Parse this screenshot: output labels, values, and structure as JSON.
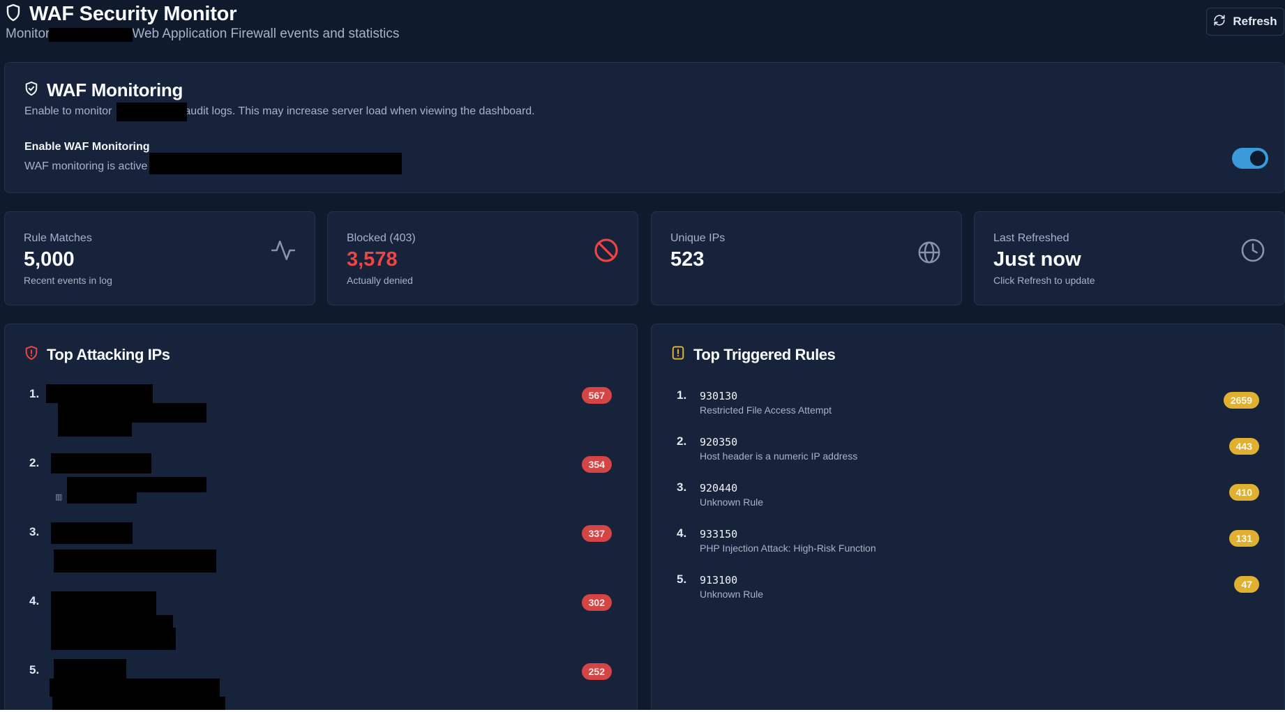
{
  "header": {
    "title": "WAF Security Monitor",
    "subtitle_start": "Monitor",
    "subtitle_end": "Web Application Firewall events and statistics",
    "refresh_label": "Refresh"
  },
  "monitoring": {
    "title": "WAF Monitoring",
    "desc_start": "Enable to monitor",
    "desc_end": "audit logs. This may increase server load when viewing the dashboard.",
    "setting_label": "Enable WAF Monitoring",
    "setting_status": "WAF monitoring is active",
    "enabled": true
  },
  "stats": [
    {
      "label": "Rule Matches",
      "value": "5,000",
      "sub": "Recent events in log",
      "icon": "activity-icon"
    },
    {
      "label": "Blocked (403)",
      "value": "3,578",
      "sub": "Actually denied",
      "icon": "ban-icon"
    },
    {
      "label": "Unique IPs",
      "value": "523",
      "sub": "",
      "icon": "globe-icon"
    },
    {
      "label": "Last Refreshed",
      "value": "Just now",
      "sub": "Click Refresh to update",
      "icon": "clock-icon"
    }
  ],
  "top_ips": {
    "title": "Top Attacking IPs",
    "items": [
      {
        "rank": "1.",
        "count": "567"
      },
      {
        "rank": "2.",
        "count": "354"
      },
      {
        "rank": "3.",
        "count": "337"
      },
      {
        "rank": "4.",
        "count": "302"
      },
      {
        "rank": "5.",
        "count": "252"
      }
    ]
  },
  "top_rules": {
    "title": "Top Triggered Rules",
    "items": [
      {
        "rank": "1.",
        "id": "930130",
        "desc": "Restricted File Access Attempt",
        "count": "2659"
      },
      {
        "rank": "2.",
        "id": "920350",
        "desc": "Host header is a numeric IP address",
        "count": "443"
      },
      {
        "rank": "3.",
        "id": "920440",
        "desc": "Unknown Rule",
        "count": "410"
      },
      {
        "rank": "4.",
        "id": "933150",
        "desc": "PHP Injection Attack: High-Risk Function",
        "count": "131"
      },
      {
        "rank": "5.",
        "id": "913100",
        "desc": "Unknown Rule",
        "count": "47"
      }
    ]
  },
  "colors": {
    "background": "#0f1a2d",
    "card": "#17233a",
    "accent": "#3b9ad9",
    "danger": "#ef4444",
    "warning": "#e0b030"
  }
}
